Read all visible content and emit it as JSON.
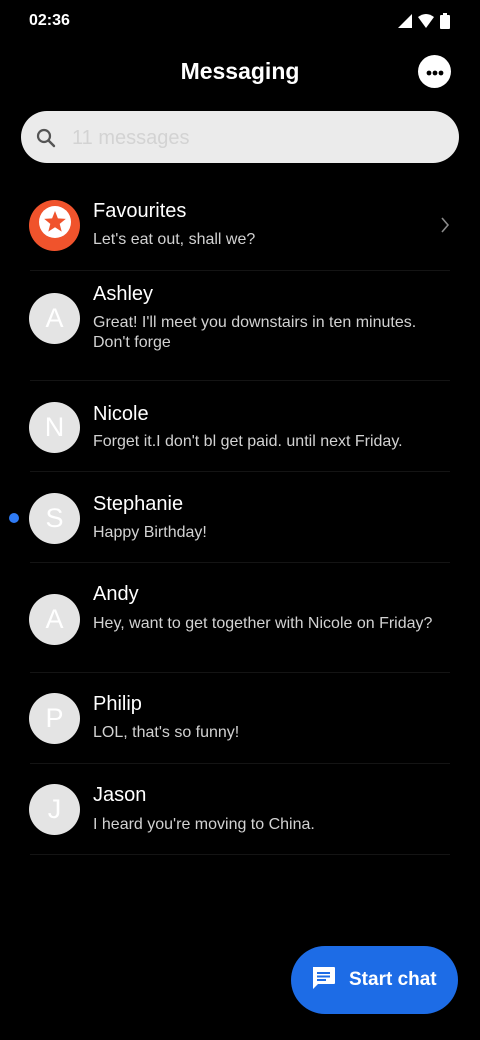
{
  "status_bar": {
    "time": "02:36",
    "icons": [
      "signal-icon",
      "wifi-icon",
      "battery-icon"
    ]
  },
  "header": {
    "title": "Messaging",
    "more_icon": "more-horizontal-icon"
  },
  "search": {
    "placeholder": "11 messages",
    "value": ""
  },
  "conversations": [
    {
      "name": "Favourites",
      "preview": "Let's eat out, shall we?",
      "avatar": "star-icon",
      "avatar_color": "#f0532c",
      "has_chevron": true
    },
    {
      "name": "Ashley",
      "preview": "Great! I'll meet you downstairs in ten minutes. Don't forge",
      "avatar_letter": "A"
    },
    {
      "name": "Nicole",
      "preview": "Forget it.I don't bl get paid. until next Friday.",
      "avatar_letter": "N"
    },
    {
      "name": "Stephanie",
      "preview": "Happy Birthday!",
      "avatar_letter": "S",
      "unread": true
    },
    {
      "name": "Andy",
      "preview": "Hey, want to get together with Nicole on Friday?",
      "avatar_letter": "A"
    },
    {
      "name": "Philip",
      "preview": "LOL, that's so funny!",
      "avatar_letter": "P"
    },
    {
      "name": "Jason",
      "preview": "I heard you're moving to China.",
      "avatar_letter": "J"
    }
  ],
  "fab": {
    "label": "Start chat",
    "icon": "chat-bubble-icon"
  },
  "colors": {
    "background": "#000000",
    "accent": "#1d6ce6",
    "unread_dot": "#2f7bf5",
    "favourite": "#f0532c",
    "avatar": "#e4e4e4"
  }
}
